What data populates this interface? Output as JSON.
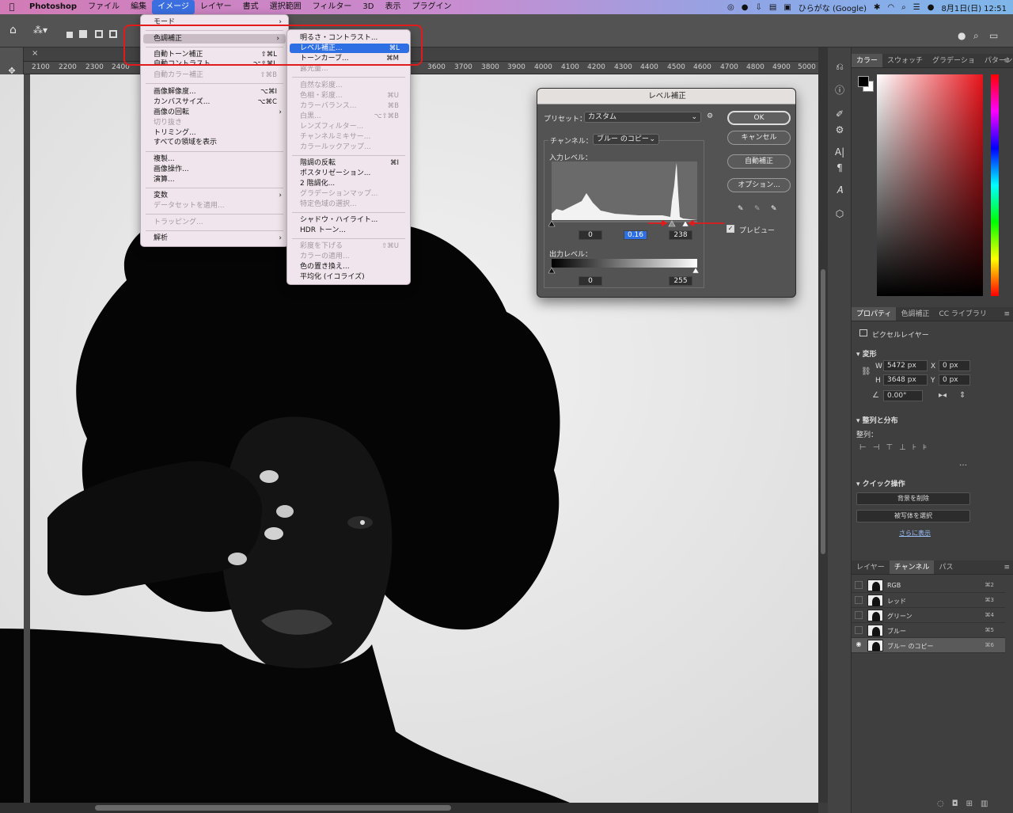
{
  "menubar": {
    "apple": "",
    "items": [
      "Photoshop",
      "ファイル",
      "編集",
      "イメージ",
      "レイヤー",
      "書式",
      "選択範囲",
      "フィルター",
      "3D",
      "表示",
      "プラグイン"
    ],
    "active_index": 3,
    "input_method": "ひらがな (Google)",
    "datetime": "8月1日(日)  12:51"
  },
  "ruler": {
    "ticks": [
      "2100",
      "2200",
      "2300",
      "2400",
      "3600",
      "3700",
      "3800",
      "3900",
      "4000",
      "4100",
      "4200",
      "4300",
      "4400",
      "4500",
      "4600",
      "4700",
      "4800",
      "4900",
      "5000"
    ]
  },
  "image_menu": {
    "items": [
      {
        "label": "モード",
        "shortcut": "",
        "arrow": true,
        "disabled": false
      },
      {
        "label": "色調補正",
        "shortcut": "",
        "arrow": true,
        "disabled": false,
        "highlighted": true
      },
      {
        "label": "自動トーン補正",
        "shortcut": "⇧⌘L",
        "arrow": false,
        "disabled": false
      },
      {
        "label": "自動コントラスト",
        "shortcut": "⌥⇧⌘L",
        "arrow": false,
        "disabled": false
      },
      {
        "label": "自動カラー補正",
        "shortcut": "⇧⌘B",
        "arrow": false,
        "disabled": true
      },
      {
        "label": "画像解像度...",
        "shortcut": "⌥⌘I",
        "arrow": false,
        "disabled": false
      },
      {
        "label": "カンバスサイズ...",
        "shortcut": "⌥⌘C",
        "arrow": false,
        "disabled": false
      },
      {
        "label": "画像の回転",
        "shortcut": "",
        "arrow": true,
        "disabled": false
      },
      {
        "label": "切り抜き",
        "shortcut": "",
        "arrow": false,
        "disabled": true
      },
      {
        "label": "トリミング...",
        "shortcut": "",
        "arrow": false,
        "disabled": false
      },
      {
        "label": "すべての領域を表示",
        "shortcut": "",
        "arrow": false,
        "disabled": false
      },
      {
        "label": "複製...",
        "shortcut": "",
        "arrow": false,
        "disabled": false
      },
      {
        "label": "画像操作...",
        "shortcut": "",
        "arrow": false,
        "disabled": false
      },
      {
        "label": "演算...",
        "shortcut": "",
        "arrow": false,
        "disabled": false
      },
      {
        "label": "変数",
        "shortcut": "",
        "arrow": true,
        "disabled": false
      },
      {
        "label": "データセットを適用...",
        "shortcut": "",
        "arrow": false,
        "disabled": true
      },
      {
        "label": "トラッピング...",
        "shortcut": "",
        "arrow": false,
        "disabled": true
      },
      {
        "label": "解析",
        "shortcut": "",
        "arrow": true,
        "disabled": false
      }
    ]
  },
  "adjust_menu": {
    "items": [
      {
        "label": "明るさ・コントラスト...",
        "shortcut": "",
        "disabled": false
      },
      {
        "label": "レベル補正...",
        "shortcut": "⌘L",
        "disabled": false,
        "highlighted": true
      },
      {
        "label": "トーンカーブ...",
        "shortcut": "⌘M",
        "disabled": false
      },
      {
        "label": "露光量...",
        "shortcut": "",
        "disabled": true
      },
      {
        "label": "自然な彩度...",
        "shortcut": "",
        "disabled": true
      },
      {
        "label": "色相・彩度...",
        "shortcut": "⌘U",
        "disabled": true
      },
      {
        "label": "カラーバランス...",
        "shortcut": "⌘B",
        "disabled": true
      },
      {
        "label": "白黒...",
        "shortcut": "⌥⇧⌘B",
        "disabled": true
      },
      {
        "label": "レンズフィルター...",
        "shortcut": "",
        "disabled": true
      },
      {
        "label": "チャンネルミキサー...",
        "shortcut": "",
        "disabled": true
      },
      {
        "label": "カラールックアップ...",
        "shortcut": "",
        "disabled": true
      },
      {
        "label": "階調の反転",
        "shortcut": "⌘I",
        "disabled": false
      },
      {
        "label": "ポスタリゼーション...",
        "shortcut": "",
        "disabled": false
      },
      {
        "label": "2 階調化...",
        "shortcut": "",
        "disabled": false
      },
      {
        "label": "グラデーションマップ...",
        "shortcut": "",
        "disabled": true
      },
      {
        "label": "特定色域の選択...",
        "shortcut": "",
        "disabled": true
      },
      {
        "label": "シャドウ・ハイライト...",
        "shortcut": "",
        "disabled": false
      },
      {
        "label": "HDR トーン...",
        "shortcut": "",
        "disabled": false
      },
      {
        "label": "彩度を下げる",
        "shortcut": "⇧⌘U",
        "disabled": true
      },
      {
        "label": "カラーの適用...",
        "shortcut": "",
        "disabled": true
      },
      {
        "label": "色の置き換え...",
        "shortcut": "",
        "disabled": false
      },
      {
        "label": "平均化 (イコライズ)",
        "shortcut": "",
        "disabled": false
      }
    ]
  },
  "levels": {
    "title": "レベル補正",
    "preset_label": "プリセット：",
    "preset_value": "カスタム",
    "channel_label": "チャンネル：",
    "channel_value": "ブルー のコピー",
    "input_label": "入力レベル：",
    "input_black": "0",
    "input_gamma": "0.16",
    "input_white": "238",
    "output_label": "出力レベル：",
    "output_black": "0",
    "output_white": "255",
    "ok": "OK",
    "cancel": "キャンセル",
    "auto": "自動補正",
    "options": "オプション...",
    "preview": "プレビュー",
    "preview_checked": true
  },
  "color_panel": {
    "tabs": [
      "カラー",
      "スウォッチ",
      "グラデーショ",
      "パターン"
    ]
  },
  "properties": {
    "tabs": [
      "プロパティ",
      "色調補正",
      "CC ライブラリ"
    ],
    "layer_type": "ピクセルレイヤー",
    "transform_title": "変形",
    "w": "5472 px",
    "h": "3648 px",
    "x": "0 px",
    "y": "0 px",
    "w_label": "W",
    "h_label": "H",
    "x_label": "X",
    "y_label": "Y",
    "angle": "0.00°",
    "align_title": "整列と分布",
    "align_label": "整列：",
    "quick_title": "クイック操作",
    "remove_bg": "背景を削除",
    "select_subject": "被写体を選択",
    "more": "さらに表示"
  },
  "channels": {
    "tabs": [
      "レイヤー",
      "チャンネル",
      "パス"
    ],
    "rows": [
      {
        "name": "RGB",
        "shortcut": "⌘2",
        "visible": false
      },
      {
        "name": "レッド",
        "shortcut": "⌘3",
        "visible": false
      },
      {
        "name": "グリーン",
        "shortcut": "⌘4",
        "visible": false
      },
      {
        "name": "ブルー",
        "shortcut": "⌘5",
        "visible": false
      },
      {
        "name": "ブルー のコピー",
        "shortcut": "⌘6",
        "visible": true
      }
    ]
  },
  "colors": {
    "highlight": "#2f6fe4",
    "annotation": "#e11b1b"
  }
}
